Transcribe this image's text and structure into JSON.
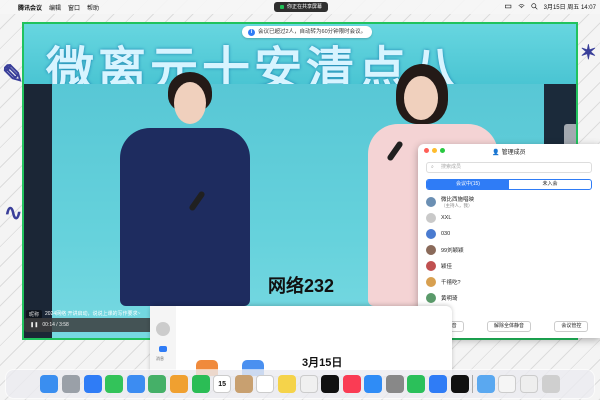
{
  "menubar": {
    "app": "腾讯会议",
    "items": [
      "编辑",
      "窗口",
      "帮助"
    ],
    "share_status": "你正在共享屏幕",
    "datetime": "3月15日 周五 14:07"
  },
  "video": {
    "banner_text": "微离元十安清点八",
    "subtitle": "网络232",
    "notice": "会议已超过2人，自动转为60分钟限时会议。",
    "chat": [
      {
        "name": "昵称",
        "text": "2024网络 开讲启动，说说上课的写作要求~"
      }
    ],
    "player_time": "00:14 / 3:58"
  },
  "panel": {
    "title": "管理成员",
    "search_placeholder": "搜索成员",
    "tabs": [
      "会议中(15)",
      "未入会"
    ],
    "members": [
      {
        "name": "微比西施唱映",
        "sub": "（主持人，我）",
        "color": "#6b8fb3"
      },
      {
        "name": "XXL",
        "sub": "",
        "color": "#c9c9c9"
      },
      {
        "name": "030",
        "sub": "",
        "color": "#4a7bd0"
      },
      {
        "name": "99刘颖颖",
        "sub": "",
        "color": "#8a6a5a"
      },
      {
        "name": "颖佳",
        "sub": "",
        "color": "#c05050"
      },
      {
        "name": "千禧吃?",
        "sub": "",
        "color": "#d8a050"
      },
      {
        "name": "黄明琦",
        "sub": "",
        "color": "#5a9a6a"
      }
    ],
    "footer_buttons": [
      "全体静音",
      "解除全体静音",
      "会议管控"
    ]
  },
  "main_window": {
    "date": "3月15日",
    "nav_label": "消息"
  },
  "dock": {
    "calendar_day": "15",
    "icons": [
      "finder-icon",
      "launchpad-icon",
      "safari-icon",
      "messages-icon",
      "mail-icon",
      "maps-icon",
      "photos-icon",
      "facetime-icon",
      "calendar-icon",
      "contacts-icon",
      "reminders-icon",
      "notes-icon",
      "freeform-icon",
      "tv-icon",
      "music-icon",
      "appstore-icon",
      "settings-icon",
      "wechat-icon",
      "tencent-meeting-icon",
      "tiktok-icon",
      "folder-icon",
      "document-icon",
      "finder-window-icon",
      "trash-icon"
    ]
  },
  "colors": {
    "accent": "#2f7cf6",
    "share_border": "#21c25e"
  }
}
